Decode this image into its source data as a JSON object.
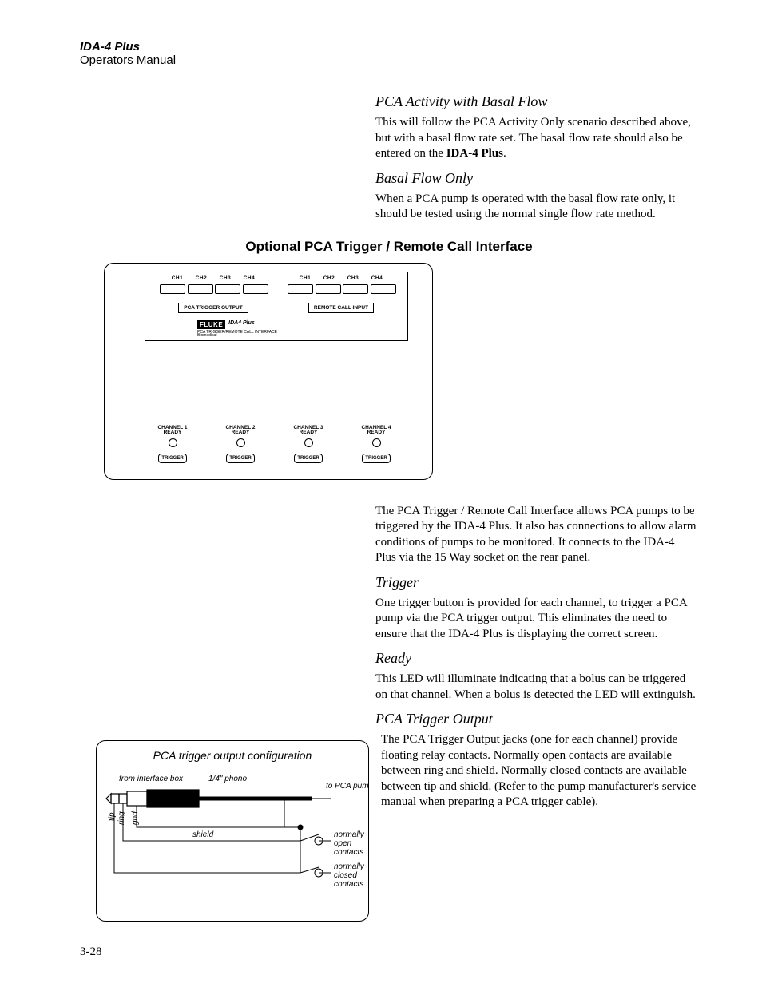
{
  "header": {
    "title": "IDA-4 Plus",
    "subtitle": "Operators Manual"
  },
  "sections": {
    "pca_basal_h": "PCA Activity with Basal Flow",
    "pca_basal_p": "This will follow the PCA Activity Only scenario described above, but with a basal flow rate set. The basal flow rate should also be entered on the ",
    "pca_basal_bold": "IDA-4 Plus",
    "pca_basal_end": ".",
    "basal_only_h": "Basal Flow Only",
    "basal_only_p": "When a PCA pump is operated with the basal flow rate only, it should be tested using the normal single flow rate method.",
    "optional_title": "Optional PCA Trigger / Remote Call Interface",
    "intro_p": "The PCA Trigger / Remote Call Interface allows PCA pumps to be triggered by the IDA-4 Plus. It also has connections to allow alarm conditions of pumps to be monitored. It connects to the IDA-4 Plus via the 15 Way socket on the rear panel.",
    "trigger_h": "Trigger",
    "trigger_p": "One trigger button is provided for each channel, to trigger a PCA pump via the PCA trigger output. This eliminates the need to ensure that the IDA-4 Plus is displaying the correct screen.",
    "ready_h": "Ready",
    "ready_p": "This LED will illuminate indicating that a bolus can be triggered on that channel. When a bolus is detected the LED will extinguish.",
    "pca_out_h": "PCA Trigger Output",
    "pca_out_p": "The PCA Trigger Output jacks (one for each channel) provide floating relay contacts. Normally open contacts are available between ring and shield.  Normally closed contacts are available between tip and shield. (Refer to the pump manufacturer's service manual when preparing a PCA trigger cable)."
  },
  "iface": {
    "ch_labels": [
      "CH1",
      "CH2",
      "CH3",
      "CH4"
    ],
    "output_label": "PCA TRIGGER OUTPUT",
    "input_label": "REMOTE CALL INPUT",
    "brand": "FLUKE",
    "brand_sub": "Biomedical",
    "brand_model": "IDA4 Plus",
    "brand_desc": "PCA TRIGGER/REMOTE CALL INTERFACE",
    "chan_ready": [
      "CHANNEL 1",
      "CHANNEL 2",
      "CHANNEL 3",
      "CHANNEL 4"
    ],
    "ready_word": "READY",
    "trigger_word": "TRIGGER"
  },
  "cable": {
    "title": "PCA trigger output configuration",
    "from": "from interface box",
    "phono": "1/4\" phono",
    "to": "to PCA pump",
    "tip": "tip",
    "ring": "ring",
    "gnd": "gnd",
    "shield": "shield",
    "nopen": "normally\nopen\ncontacts",
    "nclosed": "normally\nclosed\ncontacts"
  },
  "page_num": "3-28"
}
